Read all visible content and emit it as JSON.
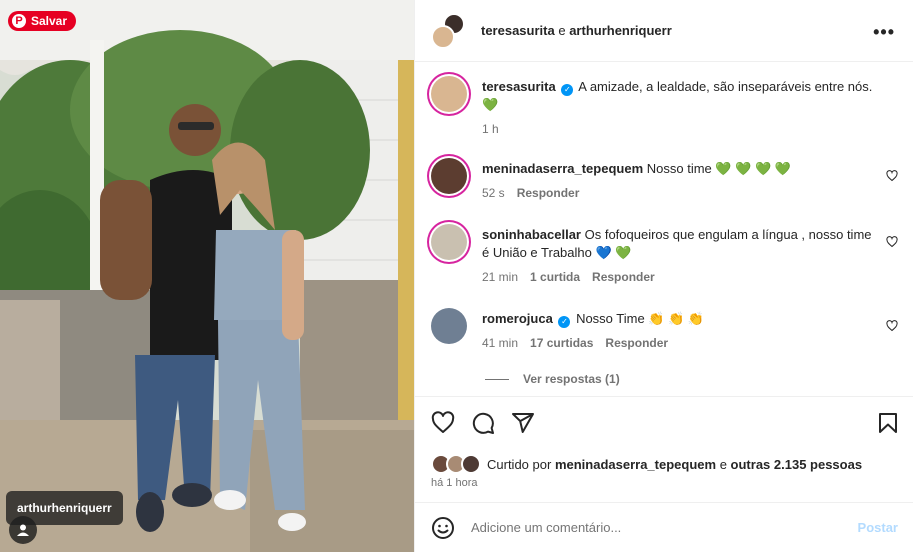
{
  "photo": {
    "save_button": "Salvar",
    "tag_user": "arthurhenriquerr"
  },
  "header": {
    "user1": "teresasurita",
    "conjunction": "e",
    "user2": "arthurhenriquerr"
  },
  "caption": {
    "user": "teresasurita",
    "text": "A amizade, a lealdade, são inseparáveis entre nós.",
    "emoji": "💚",
    "time": "1 h"
  },
  "comments": [
    {
      "user": "meninadaserra_tepequem",
      "text": "Nosso time",
      "emoji": "💚 💚 💚 💚",
      "time": "52 s",
      "likes": "",
      "reply": "Responder"
    },
    {
      "user": "soninhabacellar",
      "text": "Os fofoqueiros que engulam a língua , nosso time é União e Trabalho",
      "emoji": "💙 💚",
      "time": "21 min",
      "likes": "1 curtida",
      "reply": "Responder"
    },
    {
      "user": "romerojuca",
      "text": "Nosso Time",
      "emoji": "👏 👏 👏",
      "time": "41 min",
      "likes": "17 curtidas",
      "reply": "Responder"
    }
  ],
  "view_replies": "Ver respostas (1)",
  "likes": {
    "prefix": "Curtido por",
    "user": "meninadaserra_tepequem",
    "conjunction": "e",
    "others": "outras 2.135 pessoas"
  },
  "time_ago": "há 1 hora",
  "comment_box": {
    "placeholder": "Adicione um comentário...",
    "post_label": "Postar"
  },
  "colors": {
    "pinterest_red": "#e60023",
    "verified_blue": "#0095f6",
    "post_disabled": "#b3dbff",
    "muted_text": "#737373"
  }
}
